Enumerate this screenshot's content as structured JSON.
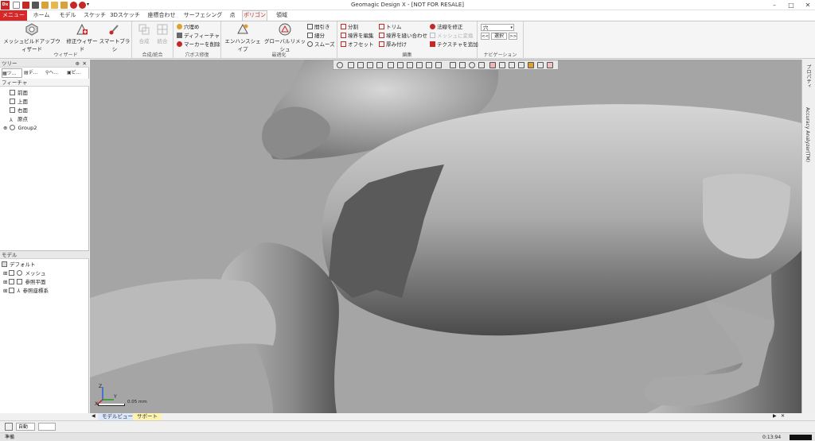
{
  "window": {
    "title": "Geomagic Design X - [NOT FOR RESALE]"
  },
  "app_logo": "Dx",
  "tabs": [
    {
      "label": "メニュー"
    },
    {
      "label": "ホーム"
    },
    {
      "label": "モデル"
    },
    {
      "label": "スケッチ"
    },
    {
      "label": "3Dスケッチ"
    },
    {
      "label": "座標合わせ"
    },
    {
      "label": "サーフェシング"
    },
    {
      "label": "点"
    },
    {
      "label": "ポリゴン"
    },
    {
      "label": "領域"
    }
  ],
  "ribbon": {
    "wizard": {
      "label": "ウィザード",
      "buttons": [
        "メッシュビルドアップウィザード",
        "修正ウィザード",
        "スマートブラシ"
      ]
    },
    "merge": {
      "label": "合成/統合",
      "buttons": [
        "合成",
        "統合"
      ]
    },
    "holes": {
      "label": "穴ボス修復",
      "buttons": [
        "穴埋め",
        "ディフィーチャ",
        "マーカーを削除"
      ]
    },
    "optimize": {
      "label": "最適化",
      "big": [
        "エンハンスシェイプ",
        "グローバルリメッシュ"
      ],
      "small": [
        "間引き",
        "細分",
        "スムーズ"
      ]
    },
    "edit": {
      "label": "編集",
      "col1": [
        "分割",
        "境界を編集",
        "オフセット"
      ],
      "col2": [
        "トリム",
        "境界を縫い合わせ",
        "厚み付け"
      ],
      "col3": [
        "法線を修正",
        "メッシュに変換",
        "テクスチャを追加"
      ]
    },
    "navigation": {
      "label": "ナビゲーション",
      "dropdown": "穴",
      "prev": "<<",
      "select": "選択",
      "next": ">>"
    }
  },
  "tree_panel": {
    "title": "ツリー",
    "tabs": [
      "ツ...",
      "デ...",
      "ヘ...",
      "ビ..."
    ],
    "section": "フィーチャ",
    "items": [
      "前面",
      "上面",
      "右面",
      "原点",
      "Group2"
    ]
  },
  "model_panel": {
    "title": "モデル",
    "items": [
      "デフォルト",
      "メッシュ",
      "参照平面",
      "参照座標系"
    ]
  },
  "viewport": {
    "scale_label": "0.05 mm",
    "axis_labels": [
      "X",
      "Y",
      "Z"
    ]
  },
  "right_strip": [
    "プロパティ",
    "Accuracy Analyzer(TM)"
  ],
  "bottom_tabs": [
    "モデルビュー",
    "サポート"
  ],
  "status": {
    "mode": "自動",
    "left_text": "準備",
    "time": "0:13:94"
  }
}
